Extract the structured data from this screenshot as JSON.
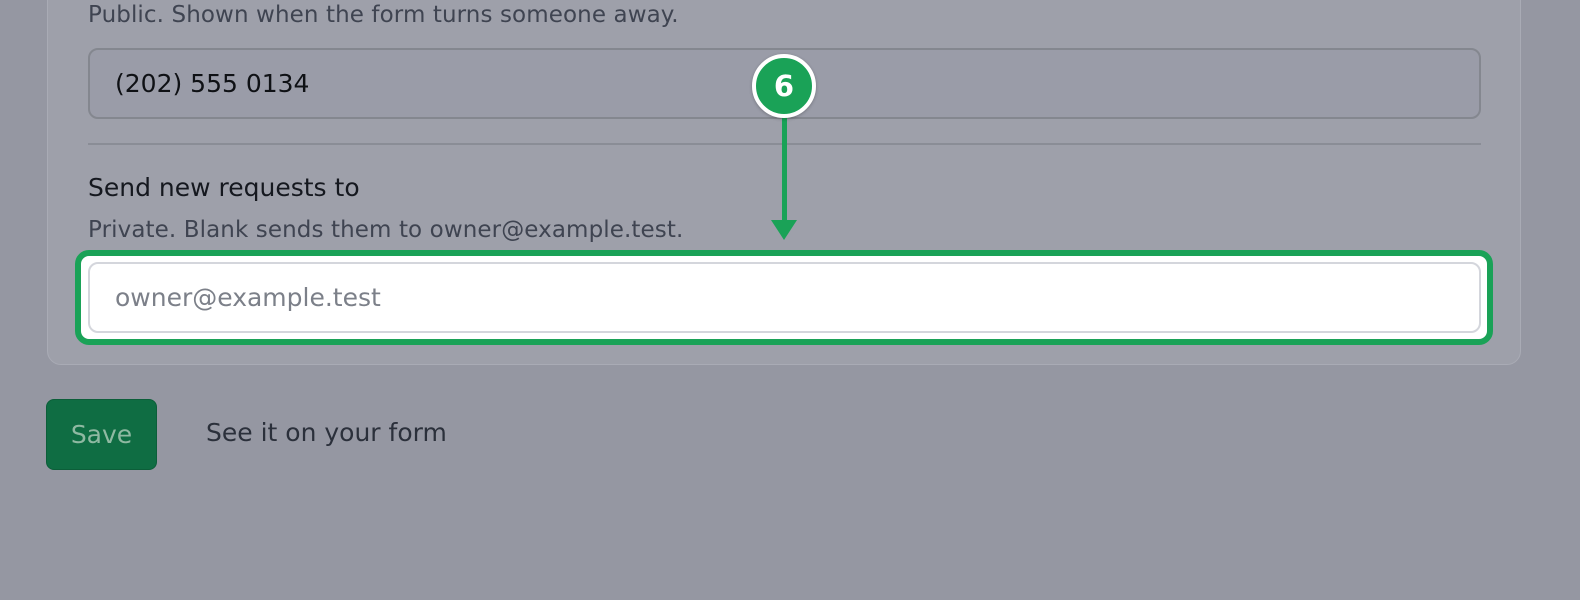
{
  "settings": {
    "phone": {
      "help_text": "Public. Shown when the form turns someone away.",
      "value": "(202) 555 0134"
    },
    "notify_email": {
      "label": "Send new requests to",
      "help_text": "Private. Blank sends them to owner@example.test.",
      "value": "",
      "placeholder": "owner@example.test"
    }
  },
  "actions": {
    "save_label": "Save",
    "preview_link_label": "See it on your form"
  },
  "annotation": {
    "step_number": "6",
    "accent_color": "#1aa257"
  },
  "colors": {
    "overlay_background": "#9597a2",
    "save_button": "#0f6d43"
  }
}
